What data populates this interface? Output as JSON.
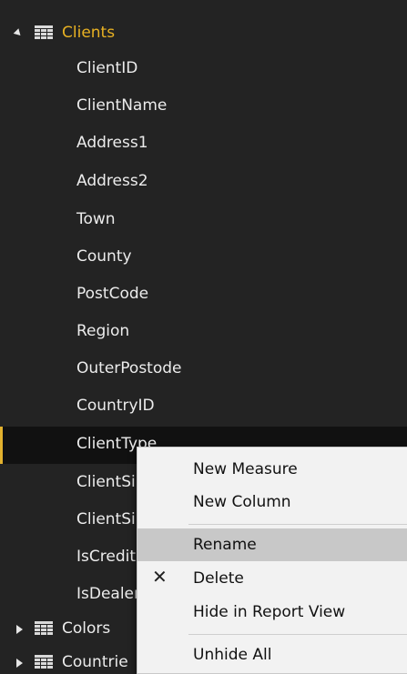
{
  "fields_pane": {
    "tables": [
      {
        "name": "Clients",
        "expanded": true,
        "columns": [
          "ClientID",
          "ClientName",
          "Address1",
          "Address2",
          "Town",
          "County",
          "PostCode",
          "Region",
          "OuterPostode",
          "CountryID",
          "ClientType",
          "ClientSi",
          "ClientSi",
          "IsCredit",
          "IsDealer"
        ],
        "selected_column": "ClientType"
      },
      {
        "name": "Colors",
        "expanded": false
      },
      {
        "name": "Countrie",
        "expanded": false
      }
    ]
  },
  "context_menu": {
    "items": [
      {
        "label": "New Measure",
        "icon": ""
      },
      {
        "label": "New Column",
        "icon": ""
      },
      {
        "label": "Rename",
        "icon": "",
        "highlighted": true
      },
      {
        "label": "Delete",
        "icon": "✕"
      },
      {
        "label": "Hide in Report View",
        "icon": ""
      },
      {
        "label": "Unhide All",
        "icon": ""
      }
    ]
  },
  "colors": {
    "pane_background": "#232323",
    "expanded_table_text": "#e8b123",
    "selected_marker": "#e2b12e",
    "menu_background": "#f2f2f2",
    "menu_highlight": "#c8c8c8"
  },
  "icons": {
    "table": "table-icon",
    "expand": "triangle-expanded-icon",
    "collapse": "triangle-collapsed-icon",
    "delete": "close-x-icon"
  }
}
